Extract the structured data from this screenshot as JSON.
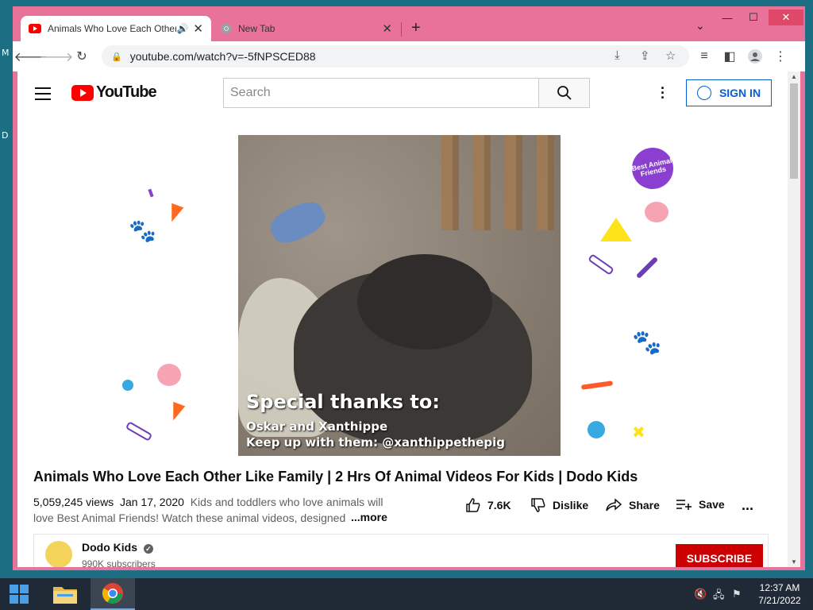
{
  "desktop": {
    "label_m": "M",
    "label_d": "D"
  },
  "browser": {
    "tabs": [
      {
        "title": "Animals Who Love Each Other Like Family",
        "active": true
      },
      {
        "title": "New Tab",
        "active": false
      }
    ],
    "url": "youtube.com/watch?v=-5fNPSCED88",
    "new_tab_symbol": "+",
    "window_controls": {
      "minimize": "—",
      "maximize": "☐",
      "close": "✕"
    }
  },
  "youtube": {
    "logo_text": "YouTube",
    "search_placeholder": "Search",
    "sign_in_label": "SIGN IN",
    "video": {
      "overlay_line1": "Special thanks to:",
      "overlay_line2": "Oskar and Xanthippe",
      "overlay_line3": "Keep up with them: @xanthippethepig",
      "badge_text": "Best Animal Friends"
    },
    "title": "Animals Who Love Each Other Like Family | 2 Hrs Of Animal Videos For Kids | Dodo Kids",
    "views": "5,059,245 views",
    "date": "Jan 17, 2020",
    "description": "Kids and toddlers who love animals will love Best Animal Friends! Watch these animal videos, designed",
    "more_label": "...more",
    "actions": {
      "likes": "7.6K",
      "dislike": "Dislike",
      "share": "Share",
      "save": "Save",
      "more": "..."
    },
    "channel": {
      "name": "Dodo Kids",
      "subscribers": "990K subscribers",
      "subscribe_label": "SUBSCRIBE"
    }
  },
  "taskbar": {
    "time": "12:37 AM",
    "date": "7/21/2022"
  }
}
